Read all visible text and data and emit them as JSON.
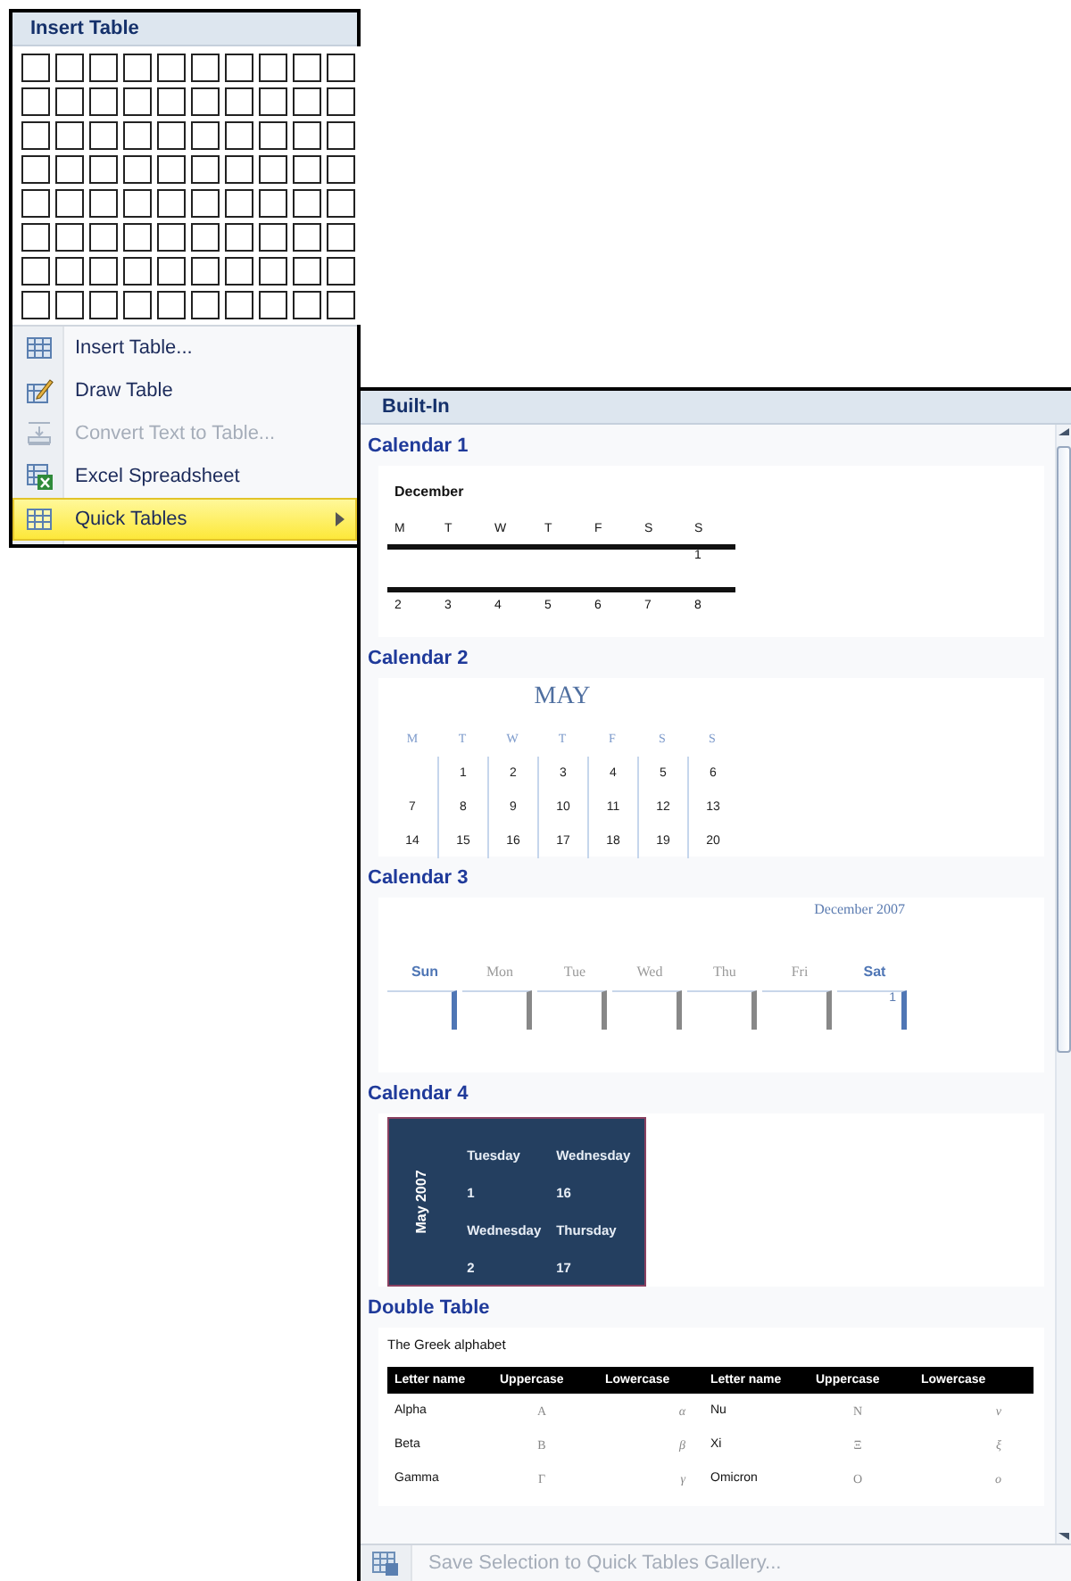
{
  "insert_table_menu": {
    "title": "Insert Table",
    "items": [
      {
        "kind": "insert",
        "label": "Insert Table...",
        "disabled": false,
        "selected": false,
        "submenu": false
      },
      {
        "kind": "draw",
        "label": "Draw Table",
        "disabled": false,
        "selected": false,
        "submenu": false
      },
      {
        "kind": "convert",
        "label": "Convert Text to Table...",
        "disabled": true,
        "selected": false,
        "submenu": false
      },
      {
        "kind": "excel",
        "label": "Excel Spreadsheet",
        "disabled": false,
        "selected": false,
        "submenu": false
      },
      {
        "kind": "quick",
        "label": "Quick Tables",
        "disabled": false,
        "selected": true,
        "submenu": true
      }
    ]
  },
  "quick_tables_gallery": {
    "header": "Built-In",
    "sections": [
      {
        "title": "Calendar 1",
        "kind": "calendar_lines",
        "month": "December",
        "days": [
          "M",
          "T",
          "W",
          "T",
          "F",
          "S",
          "S"
        ],
        "weeks": [
          {
            "starts_mid_week": true,
            "dates": [
              "1"
            ]
          },
          {
            "dates": [
              "2",
              "3",
              "4",
              "5",
              "6",
              "7",
              "8"
            ]
          }
        ]
      },
      {
        "title": "Calendar 2",
        "kind": "calendar_grid",
        "month": "MAY",
        "days": [
          "M",
          "T",
          "W",
          "T",
          "F",
          "S",
          "S"
        ],
        "weeks": [
          {
            "starts_mid_week": true,
            "dates": [
              "1",
              "2",
              "3",
              "4",
              "5",
              "6"
            ]
          },
          {
            "dates": [
              "7",
              "8",
              "9",
              "10",
              "11",
              "12",
              "13"
            ]
          },
          {
            "dates": [
              "14",
              "15",
              "16",
              "17",
              "18",
              "19",
              "20"
            ]
          }
        ]
      },
      {
        "title": "Calendar 3",
        "kind": "calendar_bars",
        "month": "December 2007",
        "days": [
          {
            "label": "Sun",
            "weekend": true
          },
          {
            "label": "Mon",
            "weekend": false
          },
          {
            "label": "Tue",
            "weekend": false
          },
          {
            "label": "Wed",
            "weekend": false
          },
          {
            "label": "Thu",
            "weekend": false
          },
          {
            "label": "Fri",
            "weekend": false
          },
          {
            "label": "Sat",
            "weekend": true
          }
        ],
        "cells": {
          "starts_mid_week": true,
          "dates": [
            "1"
          ]
        }
      },
      {
        "title": "Calendar 4",
        "kind": "calendar_block",
        "month": "May 2007",
        "rows": [
          [
            "Tuesday",
            "Wednesday"
          ],
          [
            "1",
            "16"
          ],
          [
            "Wednesday",
            "Thursday"
          ],
          [
            "2",
            "17"
          ]
        ]
      },
      {
        "title": "Double Table",
        "kind": "double_table",
        "caption": "The Greek alphabet",
        "columns": [
          "Letter name",
          "Uppercase",
          "Lowercase",
          "Letter name",
          "Uppercase",
          "Lowercase"
        ],
        "rows": [
          [
            "Alpha",
            "Α",
            "α",
            "Nu",
            "Ν",
            "ν"
          ],
          [
            "Beta",
            "Β",
            "β",
            "Xi",
            "Ξ",
            "ξ"
          ],
          [
            "Gamma",
            "Γ",
            "γ",
            "Omicron",
            "Ο",
            "ο"
          ]
        ]
      }
    ],
    "footer": {
      "label": "Save Selection to Quick Tables Gallery...",
      "disabled": true
    }
  }
}
